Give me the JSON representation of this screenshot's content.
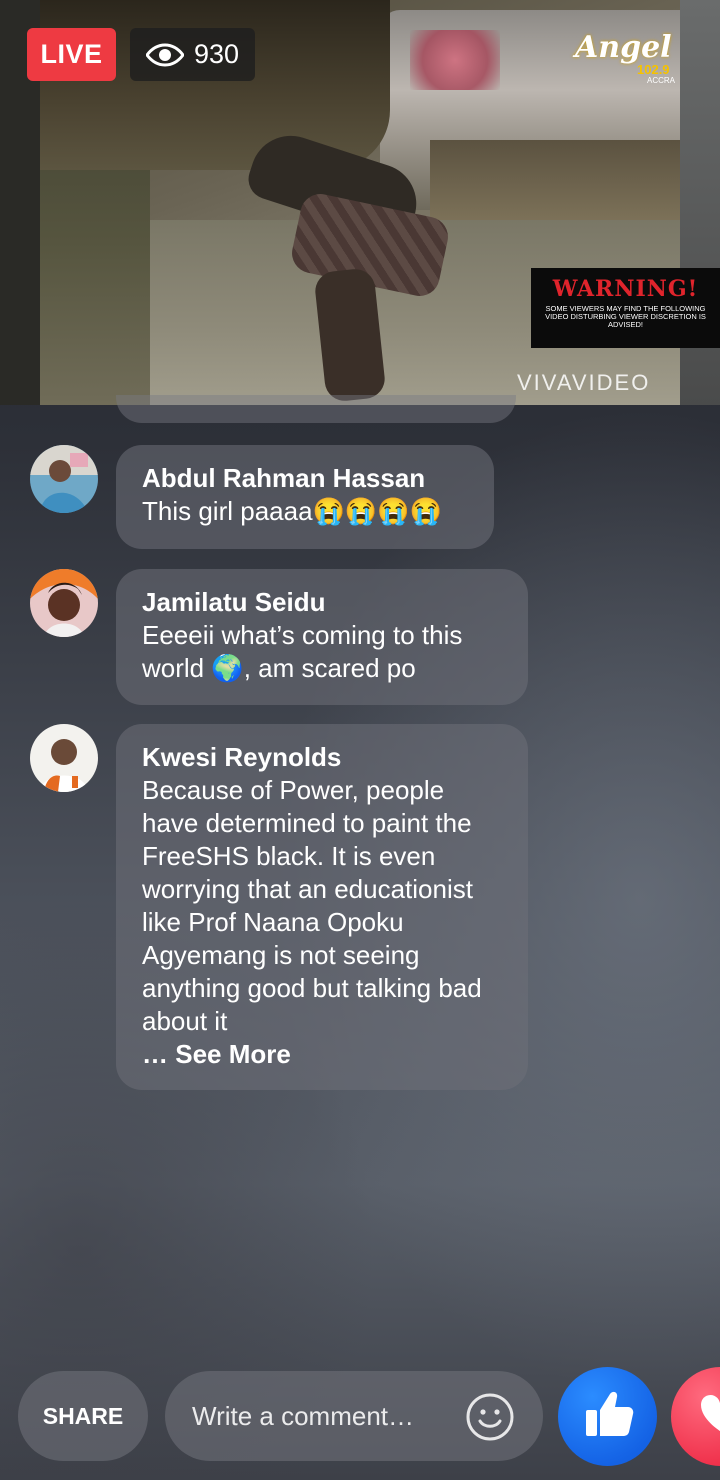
{
  "video": {
    "live_label": "LIVE",
    "viewer_count": "930",
    "logo_text": "Angel",
    "logo_frequency": "102.9",
    "logo_city": "ACCRA",
    "warning_title": "WARNING!",
    "warning_text": "Some viewers may find the following video disturbing viewer discretion is advised!",
    "watermark": "VIVAVIDEO"
  },
  "comments": [
    {
      "author": "Abdul Rahman Hassan",
      "text": "This girl paaaa😭😭😭😭"
    },
    {
      "author": "Jamilatu Seidu",
      "text": "Eeeeii what’s coming to this world 🌍, am scared po"
    },
    {
      "author": "Kwesi Reynolds",
      "text": "Because of Power, people have determined to paint the FreeSHS black. It is even worrying that an educationist like Prof Naana Opoku Agyemang is not seeing anything good but talking bad about it",
      "see_more": "… See More"
    }
  ],
  "bottom_bar": {
    "share_label": "SHARE",
    "comment_placeholder": "Write a comment…",
    "icons": [
      "smiley-icon",
      "like-thumb-icon",
      "love-heart-icon"
    ]
  },
  "colors": {
    "live_red": "#ee3a42",
    "like_blue": "#1564e6",
    "love_red": "#f0334d",
    "warning_red": "#e0242c"
  }
}
